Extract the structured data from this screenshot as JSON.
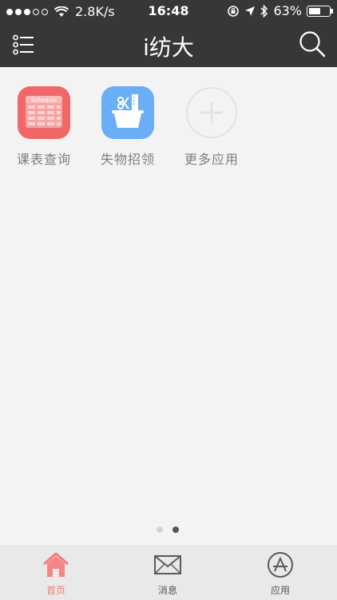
{
  "status_bar": {
    "network_speed": "2.8K/s",
    "time": "16:48",
    "battery_percent": "63%",
    "battery_level": 0.63
  },
  "header": {
    "title": "i纺大"
  },
  "apps": [
    {
      "label": "课表查询",
      "icon": "schedule-icon",
      "badge_text": "Schedule",
      "color": "#ef6766"
    },
    {
      "label": "失物招领",
      "icon": "basket-icon",
      "color": "#6aaef5"
    },
    {
      "label": "更多应用",
      "icon": "plus-icon"
    }
  ],
  "pager": {
    "pages": 2,
    "current": 2
  },
  "tab_bar": {
    "tabs": [
      {
        "label": "首页",
        "icon": "home-icon",
        "active": true
      },
      {
        "label": "消息",
        "icon": "mail-icon",
        "active": false
      },
      {
        "label": "应用",
        "icon": "app-store-icon",
        "active": false
      }
    ]
  }
}
